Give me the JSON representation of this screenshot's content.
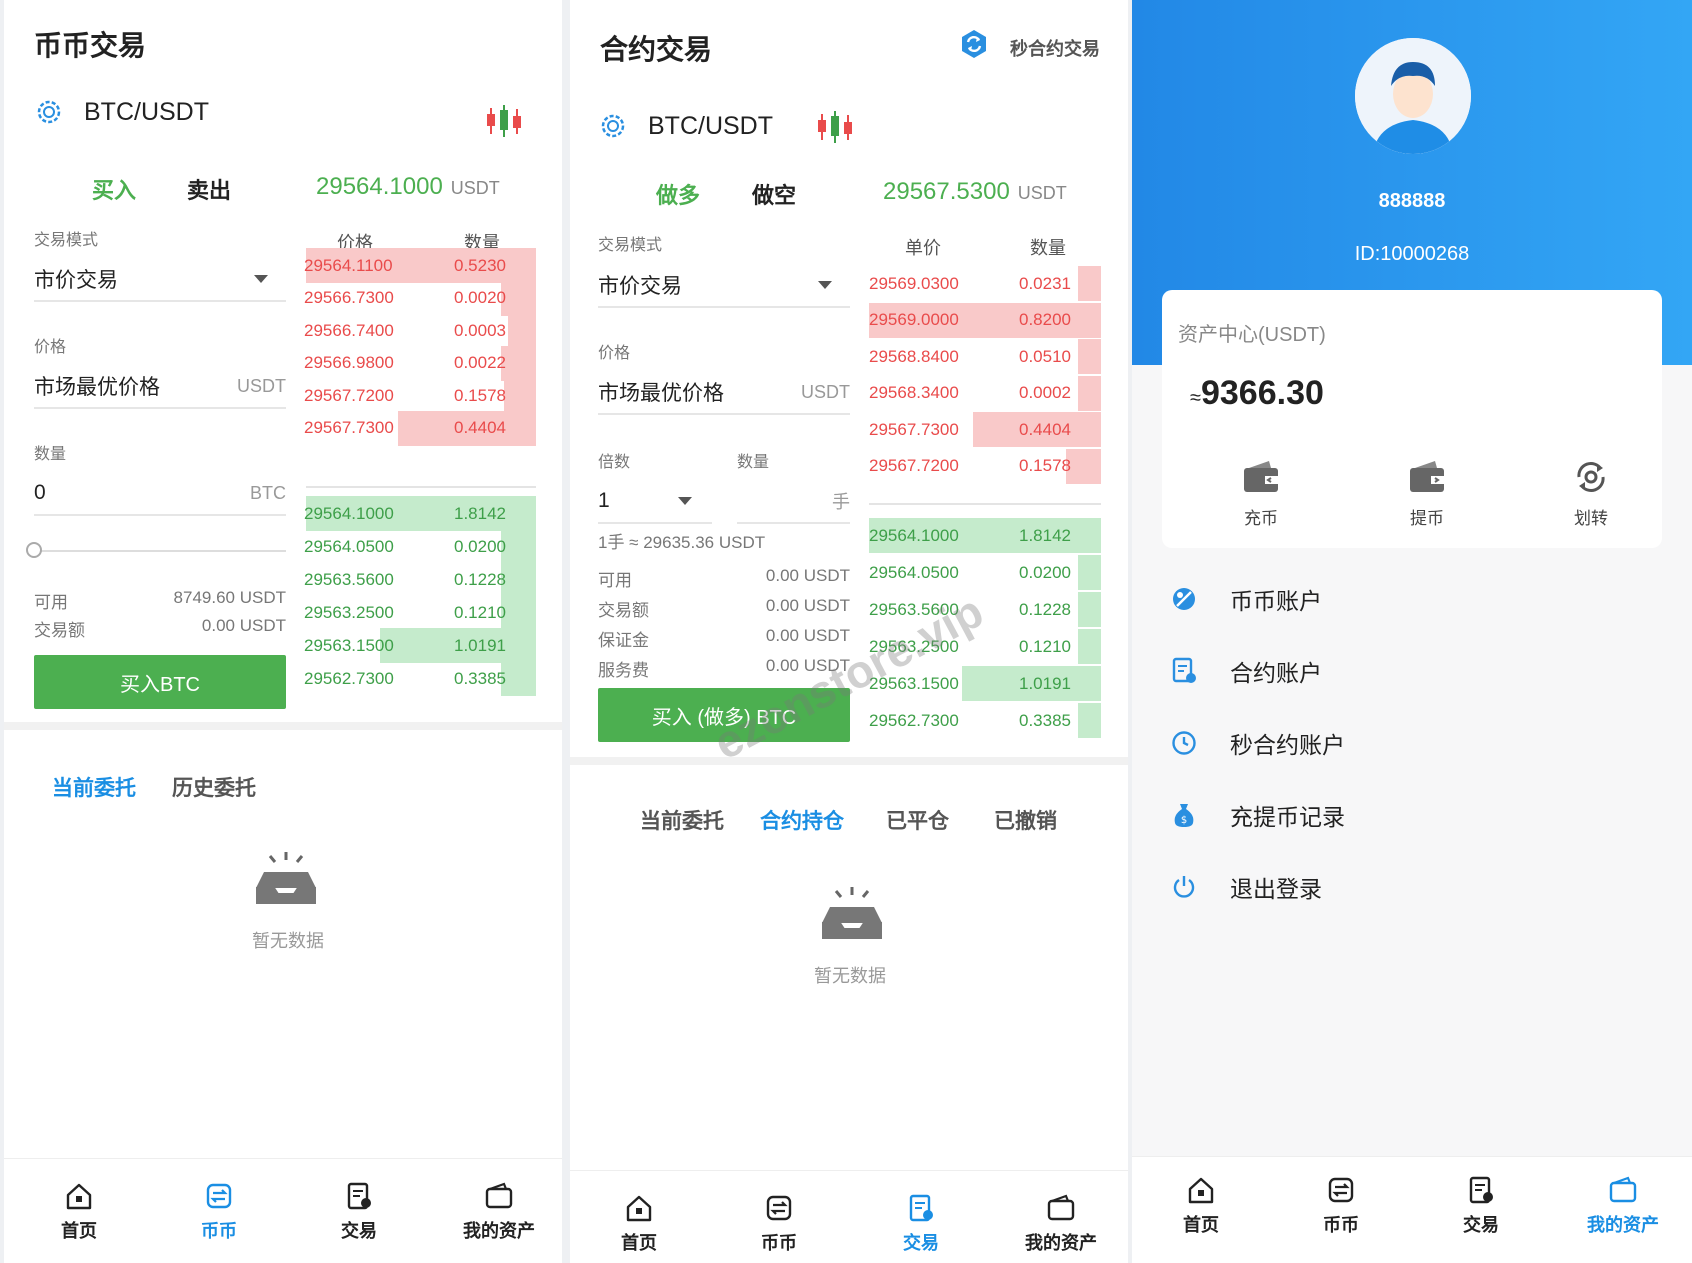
{
  "colors": {
    "green": "#4caf50",
    "red": "#e94b4b",
    "blue": "#1a8ee3"
  },
  "spot": {
    "title": "币币交易",
    "pair": "BTC/USDT",
    "buy_tab": "买入",
    "sell_tab": "卖出",
    "last_price": "29564.1000",
    "last_unit": "USDT",
    "mode_label": "交易模式",
    "mode_value": "市价交易",
    "price_label": "价格",
    "price_value": "市场最优价格",
    "price_unit": "USDT",
    "qty_label": "数量",
    "qty_value": "0",
    "qty_unit": "BTC",
    "slider_value": 0,
    "available_label": "可用",
    "available_value": "8749.60 USDT",
    "amount_label": "交易额",
    "amount_value": "0.00 USDT",
    "buy_button": "买入BTC",
    "ob_price_head": "价格",
    "ob_qty_head": "数量",
    "asks": [
      {
        "p": "29564.1100",
        "q": "0.5230",
        "depth": 1.0
      },
      {
        "p": "29566.7300",
        "q": "0.0020",
        "depth": 0.15
      },
      {
        "p": "29566.7400",
        "q": "0.0003",
        "depth": 0.12
      },
      {
        "p": "29566.9800",
        "q": "0.0022",
        "depth": 0.15
      },
      {
        "p": "29567.7200",
        "q": "0.1578",
        "depth": 0.14
      },
      {
        "p": "29567.7300",
        "q": "0.4404",
        "depth": 0.6
      }
    ],
    "bids": [
      {
        "p": "29564.1000",
        "q": "1.8142",
        "depth": 1.0
      },
      {
        "p": "29564.0500",
        "q": "0.0200",
        "depth": 0.15
      },
      {
        "p": "29563.5600",
        "q": "0.1228",
        "depth": 0.15
      },
      {
        "p": "29563.2500",
        "q": "0.1210",
        "depth": 0.15
      },
      {
        "p": "29563.1500",
        "q": "1.0191",
        "depth": 0.68
      },
      {
        "p": "29562.7300",
        "q": "0.3385",
        "depth": 0.15
      }
    ],
    "order_tabs": [
      "当前委托",
      "历史委托"
    ],
    "empty_text": "暂无数据",
    "nav": [
      "首页",
      "币币",
      "交易",
      "我的资产"
    ]
  },
  "contract": {
    "title": "合约交易",
    "second_link": "秒合约交易",
    "pair": "BTC/USDT",
    "long_tab": "做多",
    "short_tab": "做空",
    "last_price": "29567.5300",
    "last_unit": "USDT",
    "mode_label": "交易模式",
    "mode_value": "市价交易",
    "price_label": "价格",
    "price_value": "市场最优价格",
    "price_unit": "USDT",
    "leverage_label": "倍数",
    "leverage_value": "1",
    "qty_label": "数量",
    "qty_unit": "手",
    "lot_info": "1手 ≈ 29635.36 USDT",
    "available_label": "可用",
    "available_value": "0.00 USDT",
    "amount_label": "交易额",
    "amount_value": "0.00 USDT",
    "margin_label": "保证金",
    "margin_value": "0.00 USDT",
    "fee_label": "服务费",
    "fee_value": "0.00 USDT",
    "buy_button": "买入 (做多) BTC",
    "ob_price_head": "单价",
    "ob_qty_head": "数量",
    "asks": [
      {
        "p": "29569.0300",
        "q": "0.0231",
        "depth": 0.1
      },
      {
        "p": "29569.0000",
        "q": "0.8200",
        "depth": 1.0
      },
      {
        "p": "29568.8400",
        "q": "0.0510",
        "depth": 0.1
      },
      {
        "p": "29568.3400",
        "q": "0.0002",
        "depth": 0.1
      },
      {
        "p": "29567.7300",
        "q": "0.4404",
        "depth": 0.55
      },
      {
        "p": "29567.7200",
        "q": "0.1578",
        "depth": 0.15
      }
    ],
    "bids": [
      {
        "p": "29564.1000",
        "q": "1.8142",
        "depth": 1.0
      },
      {
        "p": "29564.0500",
        "q": "0.0200",
        "depth": 0.1
      },
      {
        "p": "29563.5600",
        "q": "0.1228",
        "depth": 0.1
      },
      {
        "p": "29563.2500",
        "q": "0.1210",
        "depth": 0.1
      },
      {
        "p": "29563.1500",
        "q": "1.0191",
        "depth": 0.6
      },
      {
        "p": "29562.7300",
        "q": "0.3385",
        "depth": 0.1
      }
    ],
    "order_tabs": [
      "当前委托",
      "合约持仓",
      "已平仓",
      "已撤销"
    ],
    "empty_text": "暂无数据",
    "nav": [
      "首页",
      "币币",
      "交易",
      "我的资产"
    ]
  },
  "account": {
    "username": "888888",
    "user_id": "ID:10000268",
    "asset_title": "资产中心(USDT)",
    "approx_sign": "≈",
    "asset_amount": "9366.30",
    "actions": [
      "充币",
      "提币",
      "划转"
    ],
    "menu": [
      "币币账户",
      "合约账户",
      "秒合约账户",
      "充提币记录",
      "退出登录"
    ],
    "nav": [
      "首页",
      "币币",
      "交易",
      "我的资产"
    ]
  },
  "watermark": "ezonstore.vip"
}
